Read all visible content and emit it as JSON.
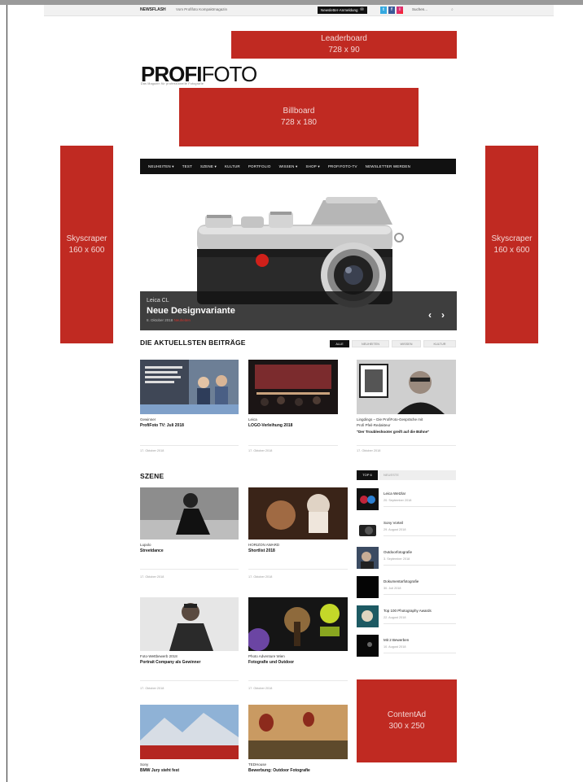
{
  "topbar": {
    "newsletter": "NEWSFLASH",
    "tagline": "Vom Profifoto Kompaktmagazin",
    "anmelden": "Newsletter-Anmeldung",
    "social": [
      "t",
      "f",
      "i"
    ],
    "search": "Suchen..."
  },
  "ads": {
    "leaderboard": {
      "name": "Leaderboard",
      "size": "728 x 90"
    },
    "billboard": {
      "name": "Billboard",
      "size": "728 x 180"
    },
    "skyscraper_left": {
      "name": "Skyscraper",
      "size": "160 x 600"
    },
    "skyscraper_right": {
      "name": "Skyscraper",
      "size": "160 x 600"
    },
    "contentad": {
      "name": "ContentAd",
      "size": "300 x 250"
    }
  },
  "logo": {
    "bold": "PROFI",
    "thin": "FOTO",
    "sub": "Das Magazin für professionelle Fotografie"
  },
  "nav": [
    "NEUHEITEN ▾",
    "TEST",
    "SZENE ▾",
    "KULTUR",
    "PORTFOLIO",
    "WISSEN ▾",
    "SHOP ▾",
    "PROFIFOTO-TV",
    "NEWSLETTER WERDEN"
  ],
  "hero": {
    "kicker": "Leica CL",
    "title": "Neue Designvariante",
    "date": "8. Oktober 2018",
    "tag": "Neuheiten",
    "prev": "‹",
    "next": "›"
  },
  "latest": {
    "title": "DIE AKTUELLSTEN BEITRÄGE",
    "filters": [
      "ALLE",
      "NEUHEITEN",
      "WISSEN",
      "KULTUR"
    ],
    "cards": [
      {
        "kicker": "Gewinner",
        "title": "ProfiFoto TV: Juli 2018",
        "date": "17. Oktober 2018"
      },
      {
        "kicker": "Leica",
        "title": "LOGO-Verleihung 2018",
        "date": "17. Oktober 2018"
      },
      {
        "kicker": "Lingdings – Die ProfiFoto-Gespräche mit",
        "title": "Profi Pfeil-Redakteur",
        "title2": "\"Der Troubleshooter greift auf die Bühne\"",
        "date": "17. Oktober 2018"
      }
    ]
  },
  "szene": {
    "title": "SZENE",
    "cards": [
      {
        "kicker": "Lupolo",
        "title": "Streetdance",
        "date": "17. Oktober 2018"
      },
      {
        "kicker": "HORIZON AWARD",
        "title": "Shortlist 2018",
        "date": "17. Oktober 2018"
      },
      {
        "kicker": "Foto-Wettbewerb 2018",
        "title": "Portrait Company als Gewinner",
        "date": "17. Oktober 2018"
      },
      {
        "kicker": "Photo Adventure Wien",
        "title": "Fotografie und Outdoor",
        "date": "17. Oktober 2018"
      },
      {
        "kicker": "Sony",
        "title": "BMW Jury steht fest",
        "date": ""
      },
      {
        "kicker": "TEDHouse",
        "title": "Bewerbung: Outdoor Fotografie",
        "date": ""
      }
    ]
  },
  "sidebar": {
    "tabs": [
      "TOP 6",
      "NEUESTE"
    ],
    "items": [
      {
        "title": "Leica Wetzlar",
        "date": "20. September 2018"
      },
      {
        "title": "Sony Vorteil",
        "date": "29. August 2018"
      },
      {
        "title": "Outdoorfotografie",
        "date": "3. September 2018"
      },
      {
        "title": "Dokumentarfotografie",
        "date": "30. Juli 2018"
      },
      {
        "title": "Top 100 Photography Awards",
        "date": "22. August 2018"
      },
      {
        "title": "Mit 2 Bewerben",
        "date": "10. August 2018"
      }
    ]
  }
}
